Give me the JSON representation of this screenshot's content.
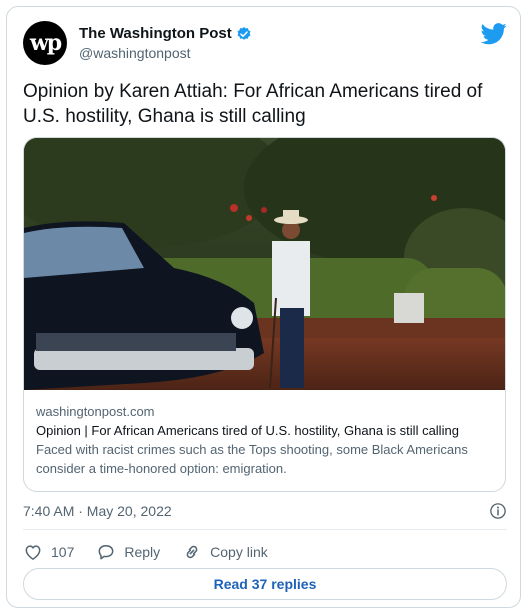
{
  "account": {
    "name": "The Washington Post",
    "handle": "@washingtonpost",
    "avatar_text": "wp"
  },
  "tweet": {
    "text": "Opinion by Karen Attiah: For African Americans tired of U.S. hostility, Ghana is still calling",
    "timestamp": "7:40 AM · May 20, 2022"
  },
  "link_card": {
    "domain": "washingtonpost.com",
    "title": "Opinion | For African Americans tired of U.S. hostility, Ghana is still calling",
    "description": "Faced with racist crimes such as the Tops shooting, some Black Americans consider a time-honored option: emigration."
  },
  "actions": {
    "like_count": "107",
    "reply_label": "Reply",
    "copy_link_label": "Copy link"
  },
  "read_replies_label": "Read 37 replies",
  "colors": {
    "accent": "#1d9bf0",
    "link": "#1d63b8",
    "muted": "#536471",
    "border": "#cfd9de"
  },
  "icons": [
    "verified-badge-icon",
    "twitter-bird-icon",
    "info-icon",
    "heart-icon",
    "reply-bubble-icon",
    "copy-link-icon"
  ]
}
